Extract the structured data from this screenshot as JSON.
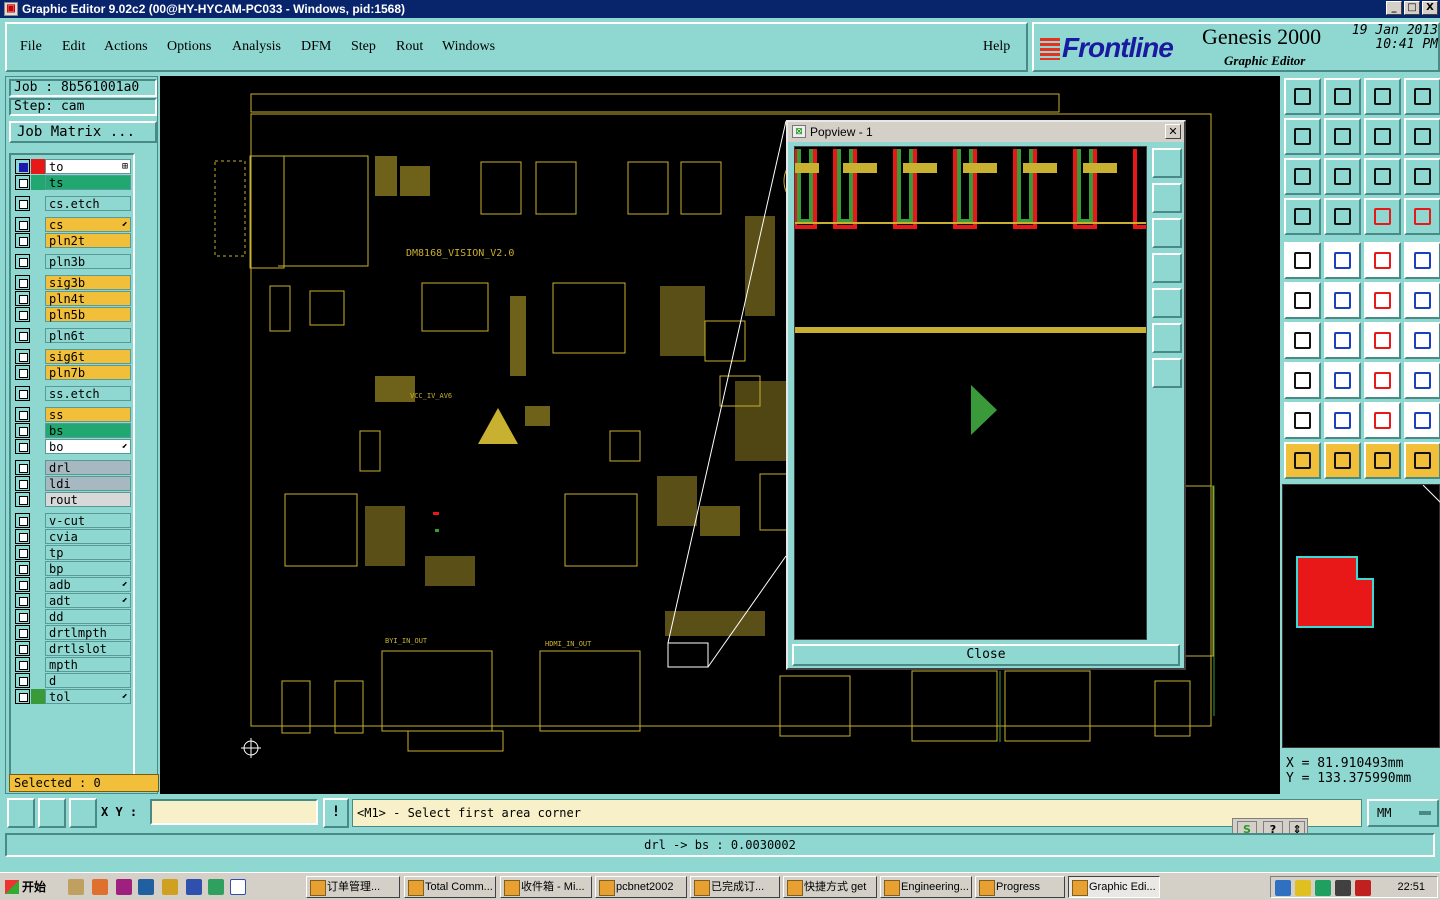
{
  "window": {
    "title": "Graphic Editor 9.02c2 (00@HY-HYCAM-PC033 - Windows, pid:1568)",
    "minimize": "_",
    "maximize": "□",
    "close": "X"
  },
  "menu": {
    "items": [
      {
        "label": "File"
      },
      {
        "label": "Edit"
      },
      {
        "label": "Actions"
      },
      {
        "label": "Options"
      },
      {
        "label": "Analysis"
      },
      {
        "label": "DFM"
      },
      {
        "label": "Step"
      },
      {
        "label": "Rout"
      },
      {
        "label": "Windows"
      }
    ],
    "help": "Help"
  },
  "brand": {
    "logo": "Frontline",
    "product": "Genesis 2000",
    "subtitle": "Graphic Editor",
    "date": "19 Jan 2013",
    "time": "10:41 PM"
  },
  "job": {
    "job_label": "Job : 8b561001a0",
    "step_label": "Step: cam",
    "job_matrix": "Job Matrix ..."
  },
  "layers": [
    {
      "name": "to",
      "color": "#e81818",
      "checked": true,
      "bg": "#ffffff",
      "mark": "⊞"
    },
    {
      "name": "ts",
      "color": "#20a870",
      "checked": false,
      "bg": "#20a870",
      "mark": ""
    },
    {
      "name": "cs.etch",
      "color": "",
      "checked": false,
      "bg": "#8fd8d2",
      "mark": ""
    },
    {
      "name": "cs",
      "color": "",
      "checked": false,
      "bg": "#f2bf3a",
      "mark": "⬋"
    },
    {
      "name": "pln2t",
      "color": "",
      "checked": false,
      "bg": "#f2bf3a",
      "mark": ""
    },
    {
      "name": "pln3b",
      "color": "",
      "checked": false,
      "bg": "#8fd8d2",
      "mark": ""
    },
    {
      "name": "sig3b",
      "color": "",
      "checked": false,
      "bg": "#f2bf3a",
      "mark": ""
    },
    {
      "name": "pln4t",
      "color": "",
      "checked": false,
      "bg": "#f2bf3a",
      "mark": ""
    },
    {
      "name": "pln5b",
      "color": "",
      "checked": false,
      "bg": "#f2bf3a",
      "mark": ""
    },
    {
      "name": "pln6t",
      "color": "",
      "checked": false,
      "bg": "#8fd8d2",
      "mark": ""
    },
    {
      "name": "sig6t",
      "color": "",
      "checked": false,
      "bg": "#f2bf3a",
      "mark": ""
    },
    {
      "name": "pln7b",
      "color": "",
      "checked": false,
      "bg": "#f2bf3a",
      "mark": ""
    },
    {
      "name": "ss.etch",
      "color": "",
      "checked": false,
      "bg": "#8fd8d2",
      "mark": ""
    },
    {
      "name": "ss",
      "color": "",
      "checked": false,
      "bg": "#f2bf3a",
      "mark": ""
    },
    {
      "name": "bs",
      "color": "",
      "checked": false,
      "bg": "#20a870",
      "mark": ""
    },
    {
      "name": "bo",
      "color": "",
      "checked": false,
      "bg": "#ffffff",
      "mark": "⬋"
    },
    {
      "name": "drl",
      "color": "",
      "checked": false,
      "bg": "#a8b8c0",
      "mark": ""
    },
    {
      "name": "ldi",
      "color": "",
      "checked": false,
      "bg": "#a8b8c0",
      "mark": ""
    },
    {
      "name": "rout",
      "color": "",
      "checked": false,
      "bg": "#d8d8d8",
      "mark": ""
    },
    {
      "name": "v-cut",
      "color": "",
      "checked": false,
      "bg": "#8fd8d2",
      "mark": ""
    },
    {
      "name": "cvia",
      "color": "",
      "checked": false,
      "bg": "#8fd8d2",
      "mark": ""
    },
    {
      "name": "tp",
      "color": "",
      "checked": false,
      "bg": "#8fd8d2",
      "mark": ""
    },
    {
      "name": "bp",
      "color": "",
      "checked": false,
      "bg": "#8fd8d2",
      "mark": ""
    },
    {
      "name": "adb",
      "color": "",
      "checked": false,
      "bg": "#8fd8d2",
      "mark": "⬋"
    },
    {
      "name": "adt",
      "color": "",
      "checked": false,
      "bg": "#8fd8d2",
      "mark": "⬋"
    },
    {
      "name": "dd",
      "color": "",
      "checked": false,
      "bg": "#8fd8d2",
      "mark": ""
    },
    {
      "name": "drtlmpth",
      "color": "",
      "checked": false,
      "bg": "#8fd8d2",
      "mark": ""
    },
    {
      "name": "drtlslot",
      "color": "",
      "checked": false,
      "bg": "#8fd8d2",
      "mark": ""
    },
    {
      "name": "mpth",
      "color": "",
      "checked": false,
      "bg": "#8fd8d2",
      "mark": ""
    },
    {
      "name": "d",
      "color": "",
      "checked": false,
      "bg": "#8fd8d2",
      "mark": ""
    },
    {
      "name": "tol",
      "color": "#3a9a3a",
      "checked": false,
      "bg": "#8fd8d2",
      "mark": "⬋"
    }
  ],
  "selected": "Selected : 0",
  "board": {
    "label": "DM8168_VISION_V2.0",
    "connector_labels": [
      "BYI_IN_OUT",
      "HDMI_IN_OUT",
      "VCC_IV_AV6"
    ]
  },
  "popview": {
    "title": "Popview - 1",
    "close_label": "Close"
  },
  "coords": {
    "x": "X  =  81.910493mm",
    "y": "Y  = 133.375990mm"
  },
  "command": {
    "xy_label": "X Y :",
    "xy_value": "",
    "excl": "!",
    "prompt": "<M1> - Select first area corner",
    "units": "MM"
  },
  "status": "drl -> bs : 0.0030002",
  "taskbar": {
    "start": "开始",
    "tasks": [
      {
        "label": "订单管理..."
      },
      {
        "label": "Total Comm..."
      },
      {
        "label": "收件箱 - Mi..."
      },
      {
        "label": "pcbnet2002"
      },
      {
        "label": "已完成订..."
      },
      {
        "label": "快捷方式 get"
      },
      {
        "label": "Engineering..."
      },
      {
        "label": "Progress"
      },
      {
        "label": "Graphic Edi..."
      }
    ],
    "clock": "22:51"
  },
  "colors": {
    "panel": "#8fd8d2",
    "board_outline": "#c8b030",
    "trace_green": "#3a9a3a",
    "selection_red": "#e81818"
  }
}
